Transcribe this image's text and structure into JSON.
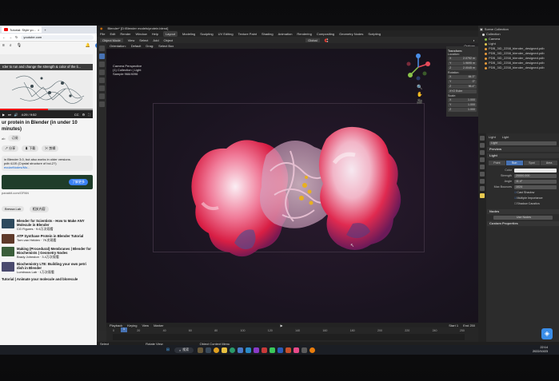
{
  "browser": {
    "tab_title": "Tutorial: Style yo...",
    "address": "youtube.com",
    "caption": "rder to run and change the strength & color of the li...",
    "timestamp": "4:29 / 9:52",
    "video_title": "ur protein in Blender (in under 10 minutes)",
    "channel": "ab",
    "subscribe_label": "订阅",
    "share_label": "分享",
    "download_label": "下载",
    "save_label": "剪辑",
    "desc_line1": "in Blender 3.0, but also works in older versions.",
    "desc_line2": "pdb 4JJ0 (Crystal structure of bcl-2?)",
    "desc_link": "ecularNodes/Mo...",
    "promo_button": "了解更多",
    "promo_url": "panabit.com/GPAN",
    "filter_chip1": "Bressa Lab",
    "filter_chip2": "相关内容",
    "recommendations": [
      {
        "title": "Blender for Scientists - How to Make ANY Molecule in Blender",
        "meta": "CG Figures · 9.6万次观看"
      },
      {
        "title": "ATP Synthase Protein in Blender Tutorial",
        "meta": "Tom van Helden · 7K次观看"
      },
      {
        "title": "Making (Procedural) Membranes | Blender for Biochemists | Geometry Nodes",
        "meta": "Brady Johnston · 3.4万次观看"
      },
      {
        "title": "Biochemistry LTE: Building your own petri dish in Blender",
        "meta": "Luminous Lab · 1万次观看"
      },
      {
        "title": "Tutorial | Animate your molecule and blorecule",
        "meta": ""
      }
    ]
  },
  "blender": {
    "window_title": "Blender* [D:\\Blender models\\protein.blend]",
    "menus": [
      "File",
      "Edit",
      "Render",
      "Window",
      "Help"
    ],
    "workspaces": [
      "Layout",
      "Modeling",
      "Sculpting",
      "UV Editing",
      "Texture Paint",
      "Shading",
      "Animation",
      "Rendering",
      "Compositing",
      "Geometry Nodes",
      "Scripting"
    ],
    "active_workspace": "Layout",
    "scene_label": "Scene",
    "viewlayer_label": "ViewLayer",
    "header_mode": "Object Mode",
    "header_items": [
      "View",
      "Select",
      "Add",
      "Object"
    ],
    "orientation": "Global",
    "toolbar2": [
      "Orientation:",
      "Default",
      "Drag:",
      "Select Box"
    ],
    "options_label": "Options",
    "overlay_lines": [
      "Camera Perspective",
      "(1) Collection | Light",
      "Sample 968/4096"
    ],
    "npanel": {
      "title": "Transform",
      "location_label": "Location:",
      "location": [
        "2.0792 m",
        "1.9695 m",
        "2.0045 m"
      ],
      "rotation_label": "Rotation:",
      "rotation": [
        "84.3°",
        "0°",
        "96.4°"
      ],
      "mode": "XYZ Euler",
      "scale_label": "Scale:",
      "scale": [
        "1.000",
        "1.000",
        "1.000"
      ]
    },
    "outliner": {
      "title": "Scene Collection",
      "items": [
        "Collection",
        "Camera",
        "Light",
        "PDB_3ID_2258_blender_designed.pdb",
        "PDB_3ID_2258_blender_designed.pdb",
        "PDB_3ID_2258_blender_designed.pdb",
        "PDB_3ID_2258_blender_designed.pdb",
        "PDB_3ID_2258_blender_designed.pdb"
      ]
    },
    "props": {
      "object": "Light",
      "data": "Light",
      "data_name": "Light",
      "sections": [
        "Preview",
        "Light"
      ],
      "light_types": [
        "Point",
        "Sun",
        "Spot",
        "Area"
      ],
      "active_light_type": "Sun",
      "fields": [
        {
          "label": "Color",
          "value": ""
        },
        {
          "label": "Strength",
          "value": "20000.000"
        },
        {
          "label": "Angle",
          "value": "11.4°"
        },
        {
          "label": "Max Bounces",
          "value": "1024"
        }
      ],
      "checks": [
        "Cast Shadow",
        "Multiple Importance",
        "Shadow Caustics"
      ],
      "nodes_label": "Nodes",
      "use_nodes": "Use Nodes",
      "custom_props": "Custom Properties"
    },
    "timeline": {
      "menus": [
        "Playback",
        "Keying",
        "View",
        "Marker"
      ],
      "current_frame": "1",
      "start": "1",
      "end": "250",
      "frames": [
        "0",
        "10",
        "20",
        "30",
        "40",
        "50",
        "60",
        "70",
        "80",
        "90",
        "100",
        "110",
        "120",
        "130",
        "140",
        "150",
        "160",
        "170",
        "180",
        "190",
        "200",
        "210",
        "220",
        "230",
        "240",
        "250"
      ]
    },
    "status": [
      "Select",
      "Rotate View",
      "Object Context Menu"
    ]
  },
  "taskbar": {
    "search_label": "搜索",
    "time": "22:14",
    "date": "2022/10/23"
  },
  "colors": {
    "accent": "#4772b3",
    "protein_red": "#e8204a",
    "protein_white": "#f4e6ee",
    "ligand": "#e8b020"
  }
}
